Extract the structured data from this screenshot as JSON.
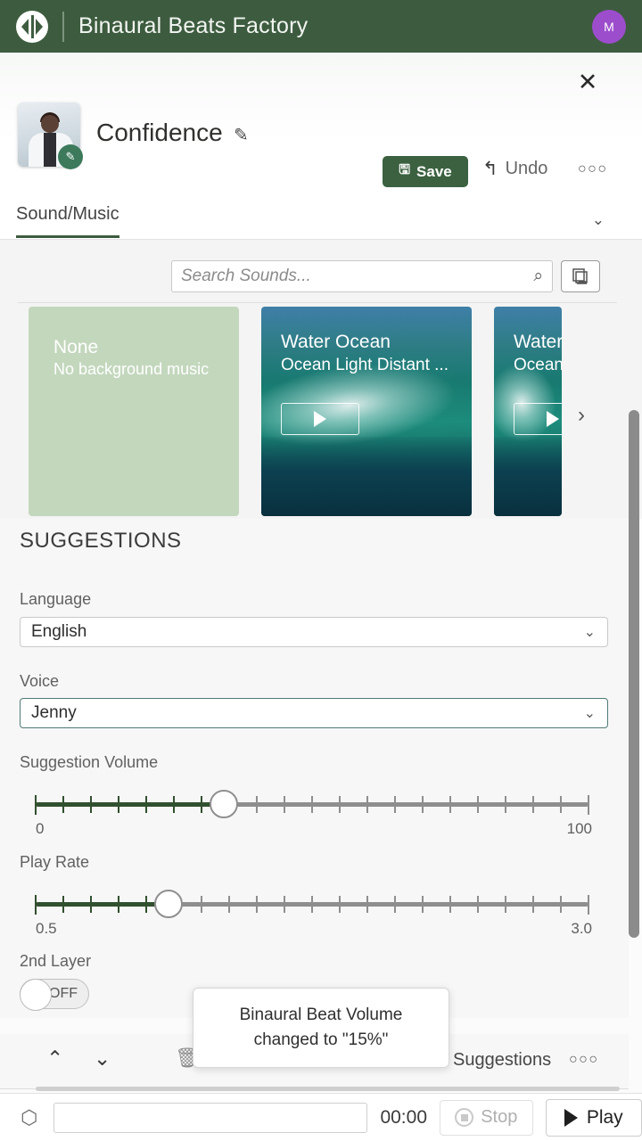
{
  "appbar": {
    "logo_icon": "binaural-logo-icon",
    "title": "Binaural Beats Factory",
    "avatar_initial": "M"
  },
  "editor": {
    "close_icon": "✕",
    "project_title": "Confidence",
    "title_edit_icon": "✎",
    "thumb_edit_icon": "✎",
    "save_label": "Save",
    "save_icon": "🖫",
    "undo_label": "Undo",
    "undo_icon": "↰",
    "more_label": "○○○",
    "collapse_icon": "⌄"
  },
  "tabs": {
    "active_label": "Sound/Music",
    "chevron_icon": "⌄"
  },
  "sound_panel": {
    "search_placeholder": "Search Sounds...",
    "search_value": "",
    "search_icon": "⌕",
    "copy_icon": "copy-icon",
    "next_icon": "›",
    "cards": [
      {
        "title": "None",
        "subtitle": "No background music",
        "kind": "none"
      },
      {
        "title": "Water Ocean",
        "subtitle": "Ocean Light Distant ...",
        "kind": "wave",
        "play_icon": "▶"
      },
      {
        "title": "Water",
        "subtitle": "Ocean",
        "kind": "wave",
        "play_icon": "▶"
      }
    ]
  },
  "suggestions": {
    "section_title": "SUGGESTIONS",
    "language_label": "Language",
    "language_value": "English",
    "voice_label": "Voice",
    "voice_value": "Jenny",
    "chevron_icon": "⌄",
    "volume": {
      "label": "Suggestion Volume",
      "min_label": "0",
      "max_label": "100",
      "value_percent": 34
    },
    "play_rate": {
      "label": "Play Rate",
      "min_label": "0.5",
      "max_label": "3.0",
      "value_percent": 24
    },
    "second_layer": {
      "label": "2nd Layer",
      "state_label": "OFF"
    }
  },
  "toolbar": {
    "up_icon": "⌃",
    "down_icon": "⌄",
    "trash_icon": "🗑",
    "item_a_icon": "▭",
    "item_b_icon": "▭",
    "suggestions_label": "Suggestions",
    "more_label": "○○○"
  },
  "toast": {
    "line1": "Binaural Beat Volume",
    "line2": "changed to \"15%\""
  },
  "player": {
    "left_icon": "⬡",
    "field_value": "",
    "time_label": "00:00",
    "stop_label": "Stop",
    "play_label": "Play"
  }
}
